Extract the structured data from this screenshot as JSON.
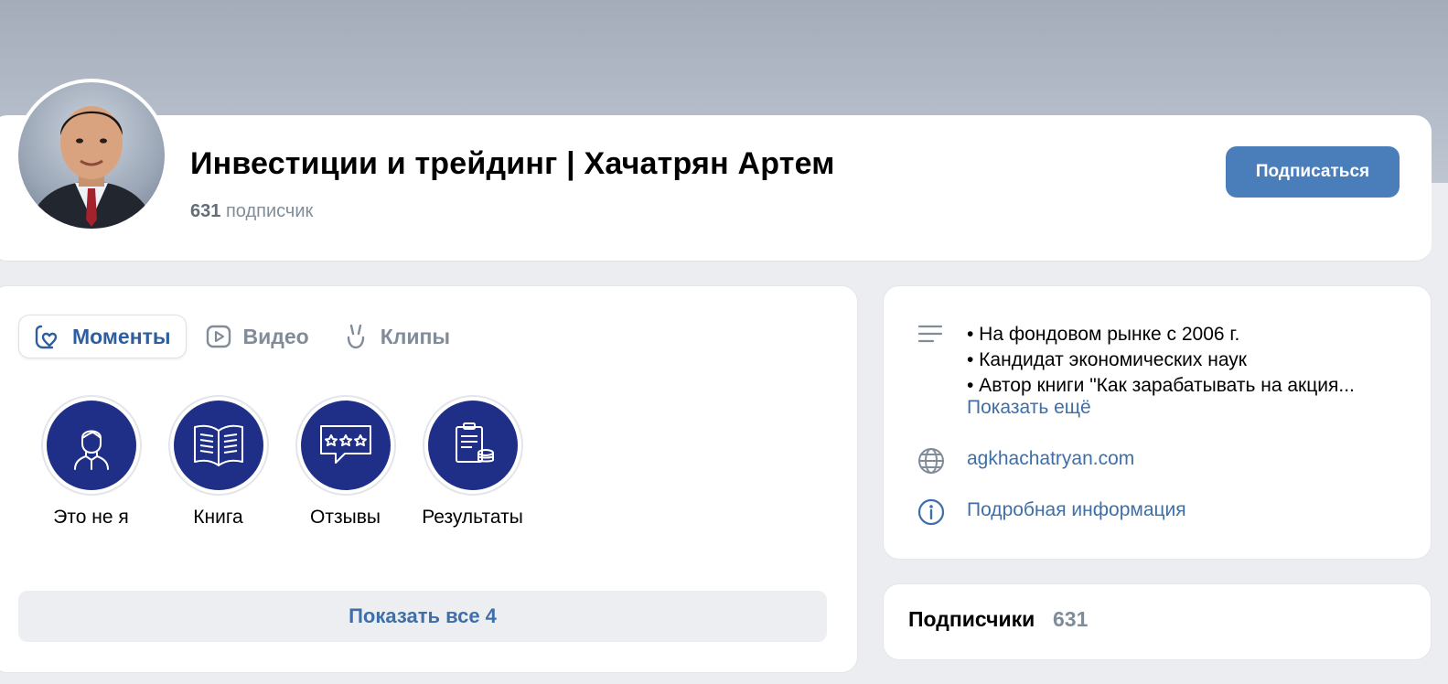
{
  "header": {
    "title": "Инвестиции и трейдинг | Хачатрян Артем",
    "subscriber_count": "631",
    "subscriber_label": "подписчик",
    "subscribe_button": "Подписаться"
  },
  "tabs": [
    {
      "label": "Моменты",
      "icon": "heart-bubble-icon",
      "active": true
    },
    {
      "label": "Видео",
      "icon": "play-icon",
      "active": false
    },
    {
      "label": "Клипы",
      "icon": "clips-icon",
      "active": false
    }
  ],
  "highlights": [
    {
      "label": "Это не я",
      "icon": "person-icon"
    },
    {
      "label": "Книга",
      "icon": "book-icon"
    },
    {
      "label": "Отзывы",
      "icon": "reviews-icon"
    },
    {
      "label": "Результаты",
      "icon": "results-icon"
    }
  ],
  "show_all_button": "Показать все 4",
  "info": {
    "description": [
      "• На фондовом рынке с 2006 г.",
      "• Кандидат экономических наук",
      "• Автор книги \"Как зарабатывать на акция..."
    ],
    "show_more": "Показать ещё",
    "website": "agkhachatryan.com",
    "details": "Подробная информация"
  },
  "subscribers_block": {
    "title": "Подписчики",
    "count": "631"
  },
  "colors": {
    "accent": "#4a7ebb",
    "link": "#3f6fa8",
    "highlight_bg": "#1f2f87",
    "muted": "#818c99"
  }
}
